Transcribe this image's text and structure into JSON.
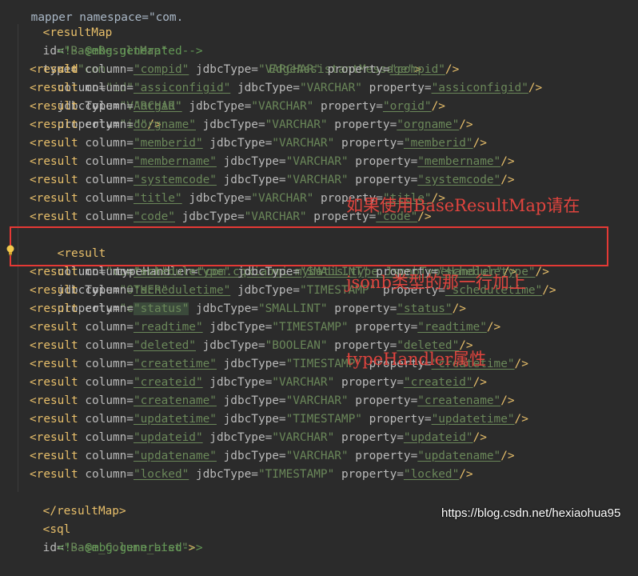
{
  "colors": {
    "background": "#2b2b2b",
    "tag": "#e8bf6a",
    "attribute": "#bababa",
    "value": "#6a8759",
    "comment": "#629755",
    "annotation": "#e0443e",
    "highlight_border": "#e53935"
  },
  "header_fragment": "mapper namespace=\"com.",
  "result_map": {
    "open_tag": "<resultMap",
    "id_attr": "id=",
    "id_value": "\"BaseResultMap\"",
    "type_attr": "type=",
    "type_value_start": "\"com.",
    "type_value_end": "EdgeAssistantMessage\"",
    "close_bracket": ">",
    "end_tag": "</resultMap>"
  },
  "comment": "<!--@mbg.generated-->",
  "id_line": {
    "tag": "<id",
    "column_attr": "column=",
    "column": "\"id\"",
    "jdbc_attr": "jdbcType=",
    "jdbc": "\"VARCHAR\"",
    "prop_attr": "property=",
    "property": "\"id\"",
    "end": "/>"
  },
  "labels": {
    "result_tag": "<result",
    "column_attr": "column=",
    "jdbc_attr": "jdbcType=",
    "prop_attr": "property=",
    "typehandler_attr": "typeHandler=",
    "self_close": "/>"
  },
  "results": [
    {
      "column": "\"compid\"",
      "jdbc": "\"VARCHAR\"",
      "property": "\"compid\""
    },
    {
      "column": "\"assiconfigid\"",
      "jdbc": "\"VARCHAR\"",
      "property": "\"assiconfigid\""
    },
    {
      "column": "\"orgid\"",
      "jdbc": "\"VARCHAR\"",
      "property": "\"orgid\""
    },
    {
      "column": "\"orgname\"",
      "jdbc": "\"VARCHAR\"",
      "property": "\"orgname\""
    },
    {
      "column": "\"memberid\"",
      "jdbc": "\"VARCHAR\"",
      "property": "\"memberid\""
    },
    {
      "column": "\"membername\"",
      "jdbc": "\"VARCHAR\"",
      "property": "\"membername\""
    },
    {
      "column": "\"systemcode\"",
      "jdbc": "\"VARCHAR\"",
      "property": "\"systemcode\""
    },
    {
      "column": "\"title\"",
      "jdbc": "\"VARCHAR\"",
      "property": "\"title\""
    },
    {
      "column": "\"code\"",
      "jdbc": "\"VARCHAR\"",
      "property": "\"code\""
    }
  ],
  "content_line": {
    "column": "\"content\"",
    "jdbc": "\"OTHER\"",
    "property": "\"content\"",
    "type_handler": "\"com.cqxiaomi.mybatis.type.JsonbTypeHandler\""
  },
  "results_after": [
    {
      "column": "\"scheduletype\"",
      "jdbc": "\"SMALLINT\"",
      "property": "\"scheduletype\""
    },
    {
      "column": "\"scheduletime\"",
      "jdbc": "\"TIMESTAMP\"",
      "property": "\"scheduletime\""
    },
    {
      "column": "\"status\"",
      "jdbc": "\"SMALLINT\"",
      "property": "\"status\""
    },
    {
      "column": "\"readtime\"",
      "jdbc": "\"TIMESTAMP\"",
      "property": "\"readtime\""
    },
    {
      "column": "\"deleted\"",
      "jdbc": "\"BOOLEAN\"",
      "property": "\"deleted\""
    },
    {
      "column": "\"createtime\"",
      "jdbc": "\"TIMESTAMP\"",
      "property": "\"createtime\""
    },
    {
      "column": "\"createid\"",
      "jdbc": "\"VARCHAR\"",
      "property": "\"createid\""
    },
    {
      "column": "\"createname\"",
      "jdbc": "\"VARCHAR\"",
      "property": "\"createname\""
    },
    {
      "column": "\"updatetime\"",
      "jdbc": "\"TIMESTAMP\"",
      "property": "\"updatetime\""
    },
    {
      "column": "\"updateid\"",
      "jdbc": "\"VARCHAR\"",
      "property": "\"updateid\""
    },
    {
      "column": "\"updatename\"",
      "jdbc": "\"VARCHAR\"",
      "property": "\"updatename\""
    },
    {
      "column": "\"locked\"",
      "jdbc": "\"TIMESTAMP\"",
      "property": "\"locked\""
    }
  ],
  "sql_line": {
    "tag": "<sql",
    "id_attr": "id=",
    "id_value": "\"Base_Column_List\"",
    "close": ">"
  },
  "bottom_fragment": "<!--@mbg.generated-->",
  "annotation": {
    "line1": "如果使用BaseResultMap请在",
    "line2": "jsonb类型的那一行加上",
    "line3": "typeHandler属性"
  },
  "watermark": "https://blog.csdn.net/hexiaohua95",
  "icons": {
    "gutter": "lightbulb-icon"
  }
}
